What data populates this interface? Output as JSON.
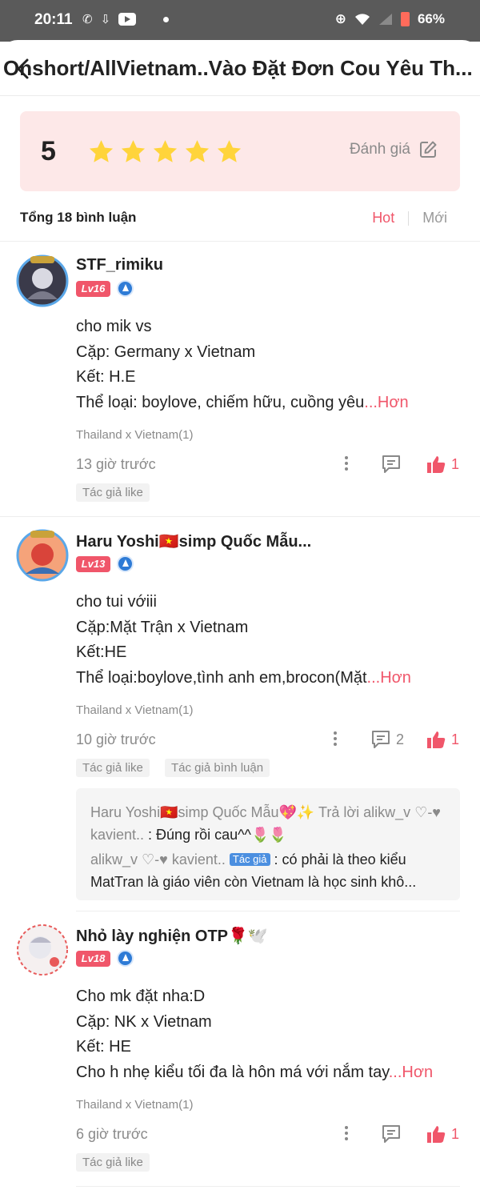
{
  "status_bar": {
    "time": "20:11",
    "icons": [
      "phone-icon",
      "download-icon",
      "youtube-icon",
      "dot-icon",
      "alarm-icon",
      "wifi-icon",
      "signal-icon",
      "battery-icon"
    ],
    "battery": "66%"
  },
  "header": {
    "title": "Onshort/AllVietnam..Vào Đặt Đơn Cou Yêu Th..."
  },
  "rating": {
    "score": "5",
    "stars": 5,
    "rate_label": "Đánh giá"
  },
  "comments_bar": {
    "total_label": "Tổng 18 bình luận",
    "sort_hot": "Hot",
    "sort_new": "Mới"
  },
  "comments": [
    {
      "username": "STF_rimiku",
      "level": "Lv16",
      "lines": [
        "cho mik vs",
        "Cặp: Germany x Vietnam",
        "Kết: H.E",
        "Thể loại: boylove, chiếm hữu, cuồng yêu"
      ],
      "more": "...Hơn",
      "chapter_tag": "Thailand x Vietnam(1)",
      "time": "13 giờ trước",
      "replies_count": "",
      "likes": "1",
      "chips": [
        "Tác giả like"
      ]
    },
    {
      "username": "Haru Yoshi🇻🇳simp Quốc Mẫu...",
      "level": "Lv13",
      "lines": [
        "cho tui vớiii",
        "Cặp:Mặt Trận x Vietnam",
        "Kết:HE",
        "Thể loại:boylove,tình anh em,brocon(Mặt"
      ],
      "more": "...Hơn",
      "chapter_tag": "Thailand x Vietnam(1)",
      "time": "10 giờ trước",
      "replies_count": "2",
      "likes": "1",
      "chips": [
        "Tác giả like",
        "Tác giả bình luận"
      ],
      "replies": [
        {
          "who": "Haru Yoshi🇻🇳simp Quốc Mẫu💖✨ Trả lời alikw_v ♡-♥ kavient..",
          "text": " : Đúng rồi cau^^🌷🌷"
        },
        {
          "who": "alikw_v ♡-♥ kavient..",
          "author_tag": "Tác giả",
          "text": " : có phải là theo kiểu MatTran là giáo viên còn Vietnam là học sinh khô..."
        }
      ]
    },
    {
      "username": "Nhỏ lày nghiện OTP🌹🕊️",
      "level": "Lv18",
      "lines": [
        "Cho mk đặt nha:D",
        "Cặp: NK x Vietnam",
        "Kết: HE",
        "Cho h nhẹ kiểu tối đa là hôn má với nắm tay"
      ],
      "more": "...Hơn",
      "chapter_tag": "Thailand x Vietnam(1)",
      "time": "6 giờ trước",
      "replies_count": "",
      "likes": "1",
      "chips": [
        "Tác giả like"
      ]
    }
  ],
  "colors": {
    "accent": "#f0566a",
    "star": "#ffd43b",
    "card_bg": "#fde8e8",
    "status_bar": "#5a5a5a"
  }
}
